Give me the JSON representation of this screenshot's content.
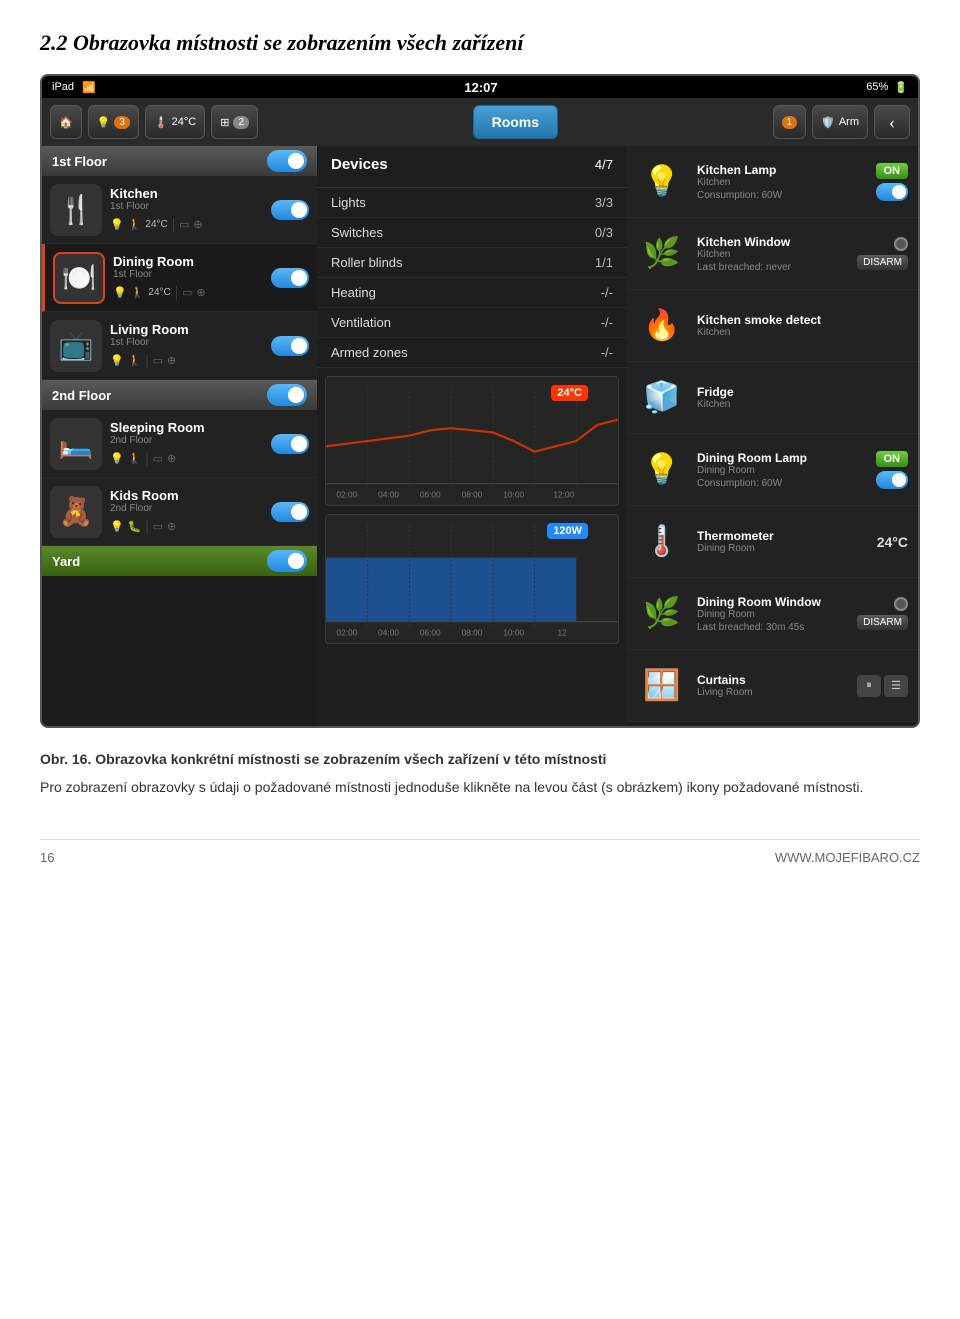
{
  "page": {
    "title": "2.2 Obrazovka místnosti se zobrazením všech zařízení"
  },
  "status_bar": {
    "device": "iPad",
    "wifi": "WiFi",
    "time": "12:07",
    "battery": "65%"
  },
  "top_nav": {
    "home_icon": "🏠",
    "light_badge": "3",
    "temp": "24°C",
    "grid_badge": "2",
    "rooms_label": "Rooms",
    "arm_badge": "1",
    "arm_label": "Arm"
  },
  "floors": [
    {
      "name": "1st Floor",
      "rooms": [
        {
          "name": "Kitchen",
          "sub": "1st Floor",
          "icon": "🍴",
          "temp": "24°C",
          "active": false
        },
        {
          "name": "Dining Room",
          "sub": "1st Floor",
          "icon": "🍽️",
          "temp": "24°C",
          "active": true
        },
        {
          "name": "Living Room",
          "sub": "1st Floor",
          "icon": "📺",
          "temp": "",
          "active": false
        }
      ]
    },
    {
      "name": "2nd Floor",
      "rooms": [
        {
          "name": "Sleeping Room",
          "sub": "2nd Floor",
          "icon": "🛏️",
          "temp": "",
          "active": false
        },
        {
          "name": "Kids Room",
          "sub": "2nd Floor",
          "icon": "🧸",
          "temp": "",
          "active": false
        }
      ]
    },
    {
      "name": "Yard",
      "rooms": []
    }
  ],
  "devices_panel": {
    "title": "Devices",
    "count": "4/7",
    "rows": [
      {
        "label": "Lights",
        "value": "3/3"
      },
      {
        "label": "Switches",
        "value": "0/3"
      },
      {
        "label": "Roller blinds",
        "value": "1/1"
      },
      {
        "label": "Heating",
        "value": "-/-"
      },
      {
        "label": "Ventilation",
        "value": "-/-"
      },
      {
        "label": "Armed zones",
        "value": "-/-"
      }
    ],
    "chart1_badge": "24°C",
    "chart2_badge": "120W",
    "chart_times": [
      "02:00",
      "04:00",
      "06:00",
      "08:00",
      "10:00",
      "12:00"
    ],
    "chart2_times": [
      "02:00",
      "04:00",
      "06:00",
      "08:00",
      "10:00",
      "12"
    ]
  },
  "right_devices": [
    {
      "name": "Kitchen Lamp",
      "room": "Kitchen",
      "icon": "💡",
      "consumption_label": "Consumption:",
      "consumption_value": "60W",
      "status": "ON",
      "ctrl": "toggle_on"
    },
    {
      "name": "Kitchen Window",
      "room": "Kitchen",
      "icon": "🌿",
      "breach_label": "Last breached:",
      "breach_value": "never",
      "status": "DISARM",
      "ctrl": "disarm"
    },
    {
      "name": "Kitchen smoke detect",
      "room": "Kitchen",
      "icon": "🔥",
      "status": "",
      "ctrl": "none"
    },
    {
      "name": "Fridge",
      "room": "Kitchen",
      "icon": "🧊",
      "status": "",
      "ctrl": "none"
    },
    {
      "name": "Dining Room Lamp",
      "room": "Dining Room",
      "icon": "💡",
      "consumption_label": "Consumption:",
      "consumption_value": "60W",
      "status": "ON",
      "ctrl": "toggle_on"
    },
    {
      "name": "Thermometer",
      "room": "Dining Room",
      "icon": "🌡️",
      "temp": "24°C",
      "status": "temp",
      "ctrl": "none"
    },
    {
      "name": "Dining Room Window",
      "room": "Dining Room",
      "icon": "🌿",
      "breach_label": "Last breached:",
      "breach_value": "30m 45s",
      "status": "DISARM",
      "ctrl": "disarm"
    },
    {
      "name": "Curtains",
      "room": "Living Room",
      "icon": "🪟",
      "status": "pause_stop",
      "ctrl": "pause_stop"
    }
  ],
  "caption": {
    "obr_label": "Obr. 16.",
    "obr_text": "Obrazovka konkrétní místnosti se zobrazením všech zařízení v této místnosti",
    "para1": "Pro zobrazení obrazovky s údaji o požadované místnosti jednoduše klikněte na levou část (s obrázkem) ikony požadované místnosti."
  },
  "footer": {
    "page_number": "16",
    "website": "WWW.MOJEFIBARO.CZ"
  }
}
